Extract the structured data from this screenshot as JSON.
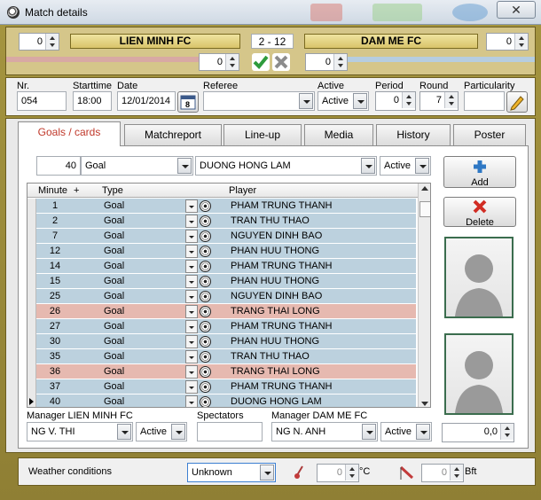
{
  "window": {
    "title": "Match details",
    "close_label": "✕"
  },
  "header": {
    "home_score": "0",
    "home_team": "LIEN MINH FC",
    "result": "2  - 12",
    "away_team": "DAM ME FC",
    "away_score": "0",
    "home_sub_score": "0",
    "away_sub_score": "0"
  },
  "info": {
    "nr_label": "Nr.",
    "nr_value": "054",
    "starttime_label": "Starttime",
    "starttime_value": "18:00",
    "date_label": "Date",
    "date_value": "12/01/2014",
    "calendar_day": "8",
    "referee_label": "Referee",
    "referee_value": "",
    "active_label": "Active",
    "active_value": "Active",
    "period_label": "Period",
    "period_value": "0",
    "round_label": "Round",
    "round_value": "7",
    "particularity_label": "Particularity",
    "particularity_value": ""
  },
  "tabs": [
    "Goals / cards",
    "Matchreport",
    "Line-up",
    "Media",
    "History",
    "Poster"
  ],
  "entry": {
    "minute": "40",
    "type": "Goal",
    "player": "DUONG HONG LAM",
    "status": "Active"
  },
  "buttons": {
    "add": "Add",
    "delete": "Delete"
  },
  "grid": {
    "headers": {
      "minute": "Minute",
      "plus": "+",
      "type": "Type",
      "player": "Player"
    },
    "rows": [
      {
        "minute": "1",
        "type": "Goal",
        "player": "PHAM TRUNG THANH",
        "color": "blue"
      },
      {
        "minute": "2",
        "type": "Goal",
        "player": "TRAN THU THAO",
        "color": "blue"
      },
      {
        "minute": "7",
        "type": "Goal",
        "player": "NGUYEN DINH BAO",
        "color": "blue"
      },
      {
        "minute": "12",
        "type": "Goal",
        "player": "PHAN HUU THONG",
        "color": "blue"
      },
      {
        "minute": "14",
        "type": "Goal",
        "player": "PHAM TRUNG THANH",
        "color": "blue"
      },
      {
        "minute": "15",
        "type": "Goal",
        "player": "PHAN HUU THONG",
        "color": "blue"
      },
      {
        "minute": "25",
        "type": "Goal",
        "player": "NGUYEN DINH BAO",
        "color": "blue"
      },
      {
        "minute": "26",
        "type": "Goal",
        "player": "TRANG THAI LONG",
        "color": "pink"
      },
      {
        "minute": "27",
        "type": "Goal",
        "player": "PHAM TRUNG THANH",
        "color": "blue"
      },
      {
        "minute": "30",
        "type": "Goal",
        "player": "PHAN HUU THONG",
        "color": "blue"
      },
      {
        "minute": "35",
        "type": "Goal",
        "player": "TRAN THU THAO",
        "color": "blue"
      },
      {
        "minute": "36",
        "type": "Goal",
        "player": "TRANG THAI LONG",
        "color": "pink"
      },
      {
        "minute": "37",
        "type": "Goal",
        "player": "PHAM TRUNG THANH",
        "color": "blue"
      },
      {
        "minute": "40",
        "type": "Goal",
        "player": "DUONG HONG LAM",
        "color": "blue"
      }
    ]
  },
  "managers": {
    "home_label": "Manager LIEN MINH FC",
    "home_name": "NG V. THI",
    "home_status": "Active",
    "spectators_label": "Spectators",
    "spectators_value": "",
    "away_label": "Manager DAM ME FC",
    "away_name": "NG N. ANH",
    "away_status": "Active",
    "rating_value": "0,0"
  },
  "weather": {
    "label": "Weather conditions",
    "value": "Unknown",
    "temperature": "0",
    "temp_unit": "°C",
    "wind": "0",
    "wind_unit": "Bft"
  },
  "colors": {
    "row_blue": "#bcd1de",
    "row_pink": "#e6b9b0",
    "active_tab_text": "#c0392b",
    "frame": "#9c8a3c"
  }
}
